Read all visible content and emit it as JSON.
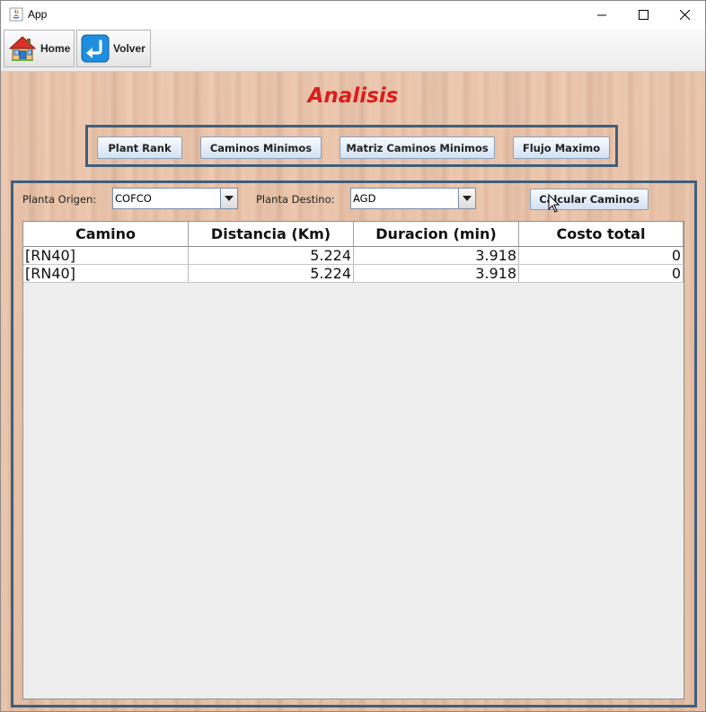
{
  "window": {
    "title": "App"
  },
  "toolbar": {
    "home_label": "Home",
    "back_label": "Volver"
  },
  "heading": "Analisis",
  "analysis_buttons": {
    "plant_rank": "Plant Rank",
    "caminos_minimos": "Caminos Minimos",
    "matriz_caminos_minimos": "Matriz Caminos Minimos",
    "flujo_maximo": "Flujo Maximo"
  },
  "form": {
    "origen_label": "Planta Origen:",
    "origen_value": "COFCO",
    "destino_label": "Planta Destino:",
    "destino_value": "AGD",
    "calcular_label": "Calcular Caminos"
  },
  "table": {
    "columns": [
      "Camino",
      "Distancia (Km)",
      "Duracion (min)",
      "Costo total"
    ],
    "rows": [
      [
        "[RN40]",
        "5.224",
        "3.918",
        "0"
      ],
      [
        "[RN40]",
        "5.224",
        "3.918",
        "0"
      ]
    ]
  },
  "colors": {
    "heading": "#dd1d1d",
    "box_border": "#3f5f7f"
  }
}
